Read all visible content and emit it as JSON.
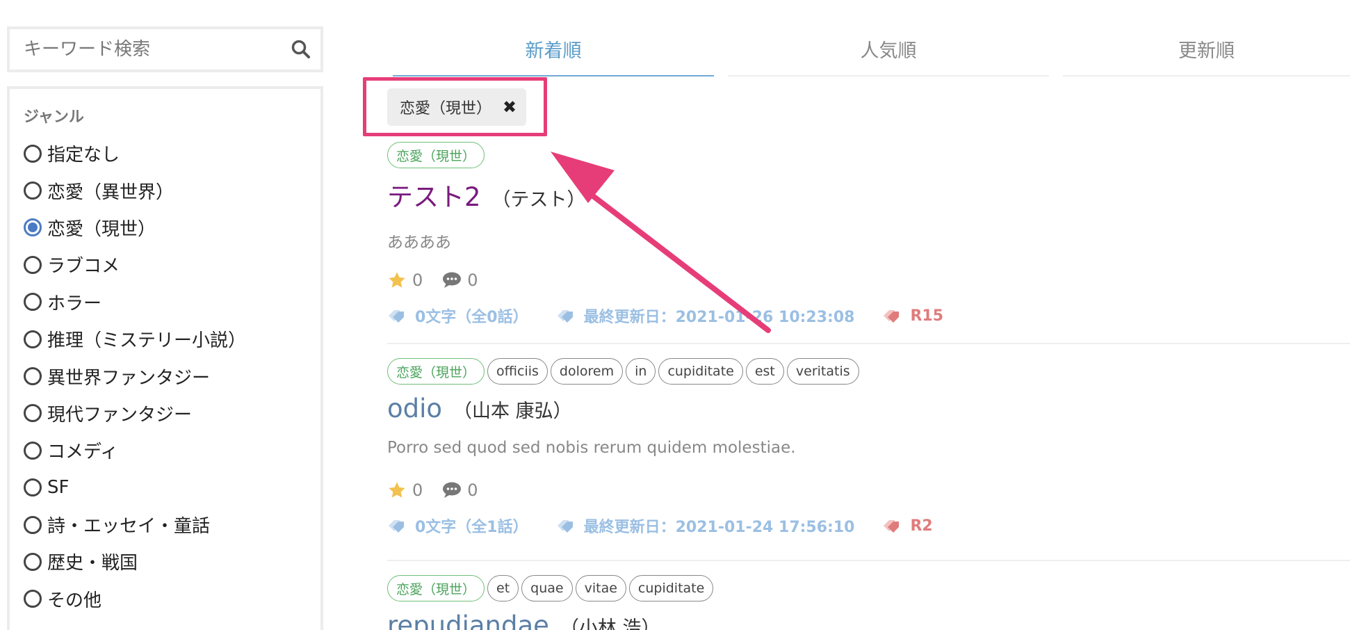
{
  "search": {
    "placeholder": "キーワード検索"
  },
  "genre": {
    "title": "ジャンル",
    "options": [
      {
        "label": "指定なし",
        "checked": false
      },
      {
        "label": "恋愛（異世界）",
        "checked": false
      },
      {
        "label": "恋愛（現世）",
        "checked": true
      },
      {
        "label": "ラブコメ",
        "checked": false
      },
      {
        "label": "ホラー",
        "checked": false
      },
      {
        "label": "推理（ミステリー小説）",
        "checked": false
      },
      {
        "label": "異世界ファンタジー",
        "checked": false
      },
      {
        "label": "現代ファンタジー",
        "checked": false
      },
      {
        "label": "コメディ",
        "checked": false
      },
      {
        "label": "SF",
        "checked": false
      },
      {
        "label": "詩・エッセイ・童話",
        "checked": false
      },
      {
        "label": "歴史・戦国",
        "checked": false
      },
      {
        "label": "その他",
        "checked": false
      }
    ]
  },
  "tabs": [
    {
      "label": "新着順",
      "active": true
    },
    {
      "label": "人気順",
      "active": false
    },
    {
      "label": "更新順",
      "active": false
    }
  ],
  "active_filter": {
    "label": "恋愛（現世）",
    "remove_symbol": "✖"
  },
  "colors": {
    "accent": "#5b9cc8",
    "highlight": "#e63d78",
    "genre_tag": "#4aa35b",
    "meta_blue": "#9bbfe3",
    "meta_red": "#e07b7b"
  },
  "works": [
    {
      "tags": [
        "恋愛（現世）"
      ],
      "title": "テスト2",
      "author": "（テスト）",
      "description": "ああああ",
      "stars": "0",
      "comments": "0",
      "word_count": "0文字（全0話）",
      "updated": "最終更新日：2021-01-26 10:23:08",
      "rating": "R15"
    },
    {
      "tags": [
        "恋愛（現世）",
        "officiis",
        "dolorem",
        "in",
        "cupiditate",
        "est",
        "veritatis"
      ],
      "title": "odio",
      "author": "（山本 康弘）",
      "description": "Porro sed quod sed nobis rerum quidem molestiae.",
      "stars": "0",
      "comments": "0",
      "word_count": "0文字（全1話）",
      "updated": "最終更新日：2021-01-24 17:56:10",
      "rating": "R2"
    },
    {
      "tags": [
        "恋愛（現世）",
        "et",
        "quae",
        "vitae",
        "cupiditate"
      ],
      "title": "repudiandae",
      "author": "（小林 浩）"
    }
  ]
}
